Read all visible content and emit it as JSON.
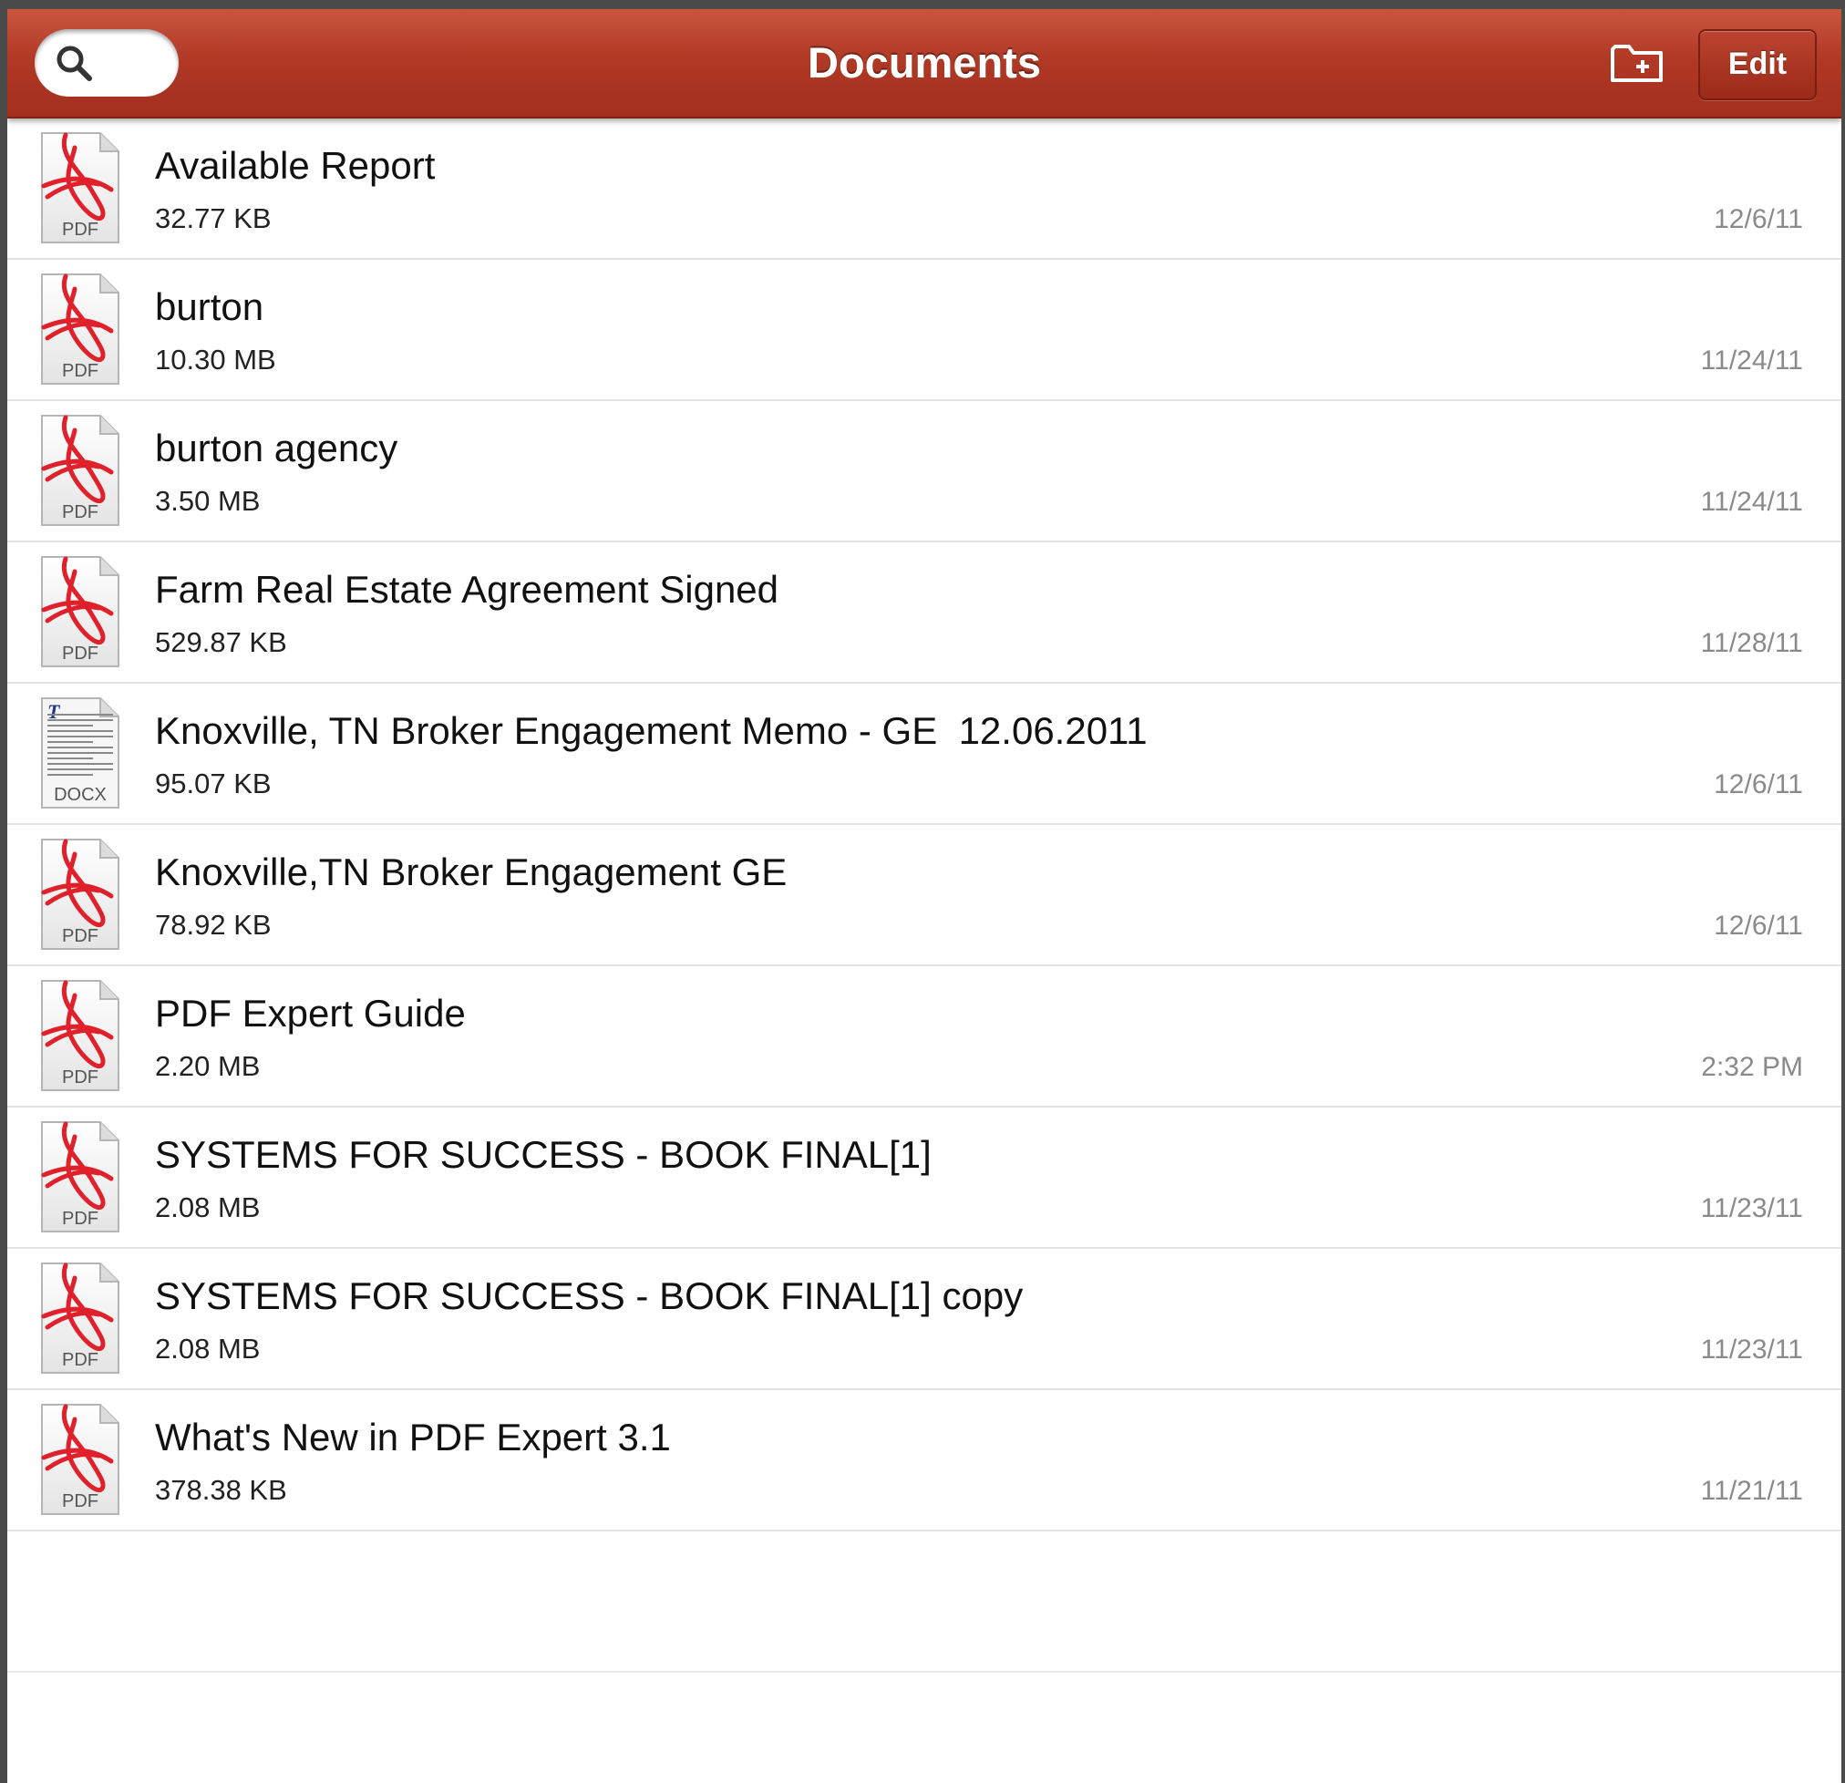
{
  "navbar": {
    "title": "Documents",
    "edit_label": "Edit",
    "search_icon": "search-icon",
    "new_folder_icon": "new-folder-icon",
    "color": "#b13a26"
  },
  "files": [
    {
      "name": "Available Report",
      "size": "32.77 KB",
      "date": "12/6/11",
      "type": "PDF"
    },
    {
      "name": "burton",
      "size": "10.30 MB",
      "date": "11/24/11",
      "type": "PDF"
    },
    {
      "name": "burton agency",
      "size": "3.50 MB",
      "date": "11/24/11",
      "type": "PDF"
    },
    {
      "name": "Farm Real Estate Agreement Signed",
      "size": "529.87 KB",
      "date": "11/28/11",
      "type": "PDF"
    },
    {
      "name": "Knoxville, TN Broker Engagement Memo - GE  12.06.2011",
      "size": "95.07 KB",
      "date": "12/6/11",
      "type": "DOCX"
    },
    {
      "name": "Knoxville,TN Broker Engagement GE",
      "size": "78.92 KB",
      "date": "12/6/11",
      "type": "PDF"
    },
    {
      "name": "PDF Expert Guide",
      "size": "2.20 MB",
      "date": "2:32 PM",
      "type": "PDF"
    },
    {
      "name": "SYSTEMS FOR SUCCESS - BOOK FINAL[1]",
      "size": "2.08 MB",
      "date": "11/23/11",
      "type": "PDF"
    },
    {
      "name": "SYSTEMS FOR SUCCESS - BOOK FINAL[1] copy",
      "size": "2.08 MB",
      "date": "11/23/11",
      "type": "PDF"
    },
    {
      "name": "What's New in PDF Expert 3.1",
      "size": "378.38 KB",
      "date": "11/21/11",
      "type": "PDF"
    }
  ]
}
